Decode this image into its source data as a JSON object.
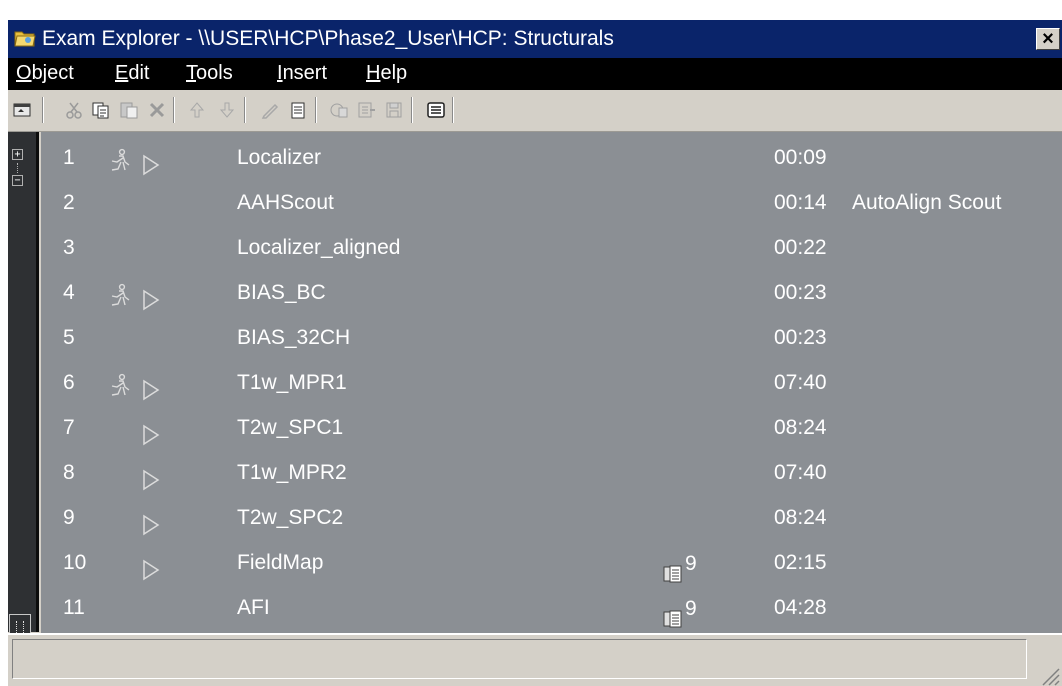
{
  "window": {
    "title": "Exam Explorer - \\\\USER\\HCP\\Phase2_User\\HCP: Structurals",
    "close_label": "×"
  },
  "menu": [
    "Object",
    "Edit",
    "Tools",
    "Insert",
    "Help"
  ],
  "toolbar": {
    "buttons": [
      "view-icon",
      "cut-icon",
      "copy-icon",
      "paste-icon",
      "delete-icon",
      "move-up-icon",
      "move-down-icon",
      "edit-icon",
      "properties-icon",
      "import-icon",
      "export-icon",
      "save-icon",
      "list-icon"
    ]
  },
  "tree": {
    "expand_glyph": "+",
    "collapse_glyph": "−"
  },
  "protocols": [
    {
      "num": "1",
      "name": "Localizer",
      "time": "00:09",
      "info": "",
      "patient_icon": true,
      "arrow": true,
      "images": ""
    },
    {
      "num": "2",
      "name": "AAHScout",
      "time": "00:14",
      "info": "AutoAlign Scout",
      "patient_icon": false,
      "arrow": false,
      "images": ""
    },
    {
      "num": "3",
      "name": "Localizer_aligned",
      "time": "00:22",
      "info": "",
      "patient_icon": false,
      "arrow": false,
      "images": ""
    },
    {
      "num": "4",
      "name": "BIAS_BC",
      "time": "00:23",
      "info": "",
      "patient_icon": true,
      "arrow": true,
      "images": ""
    },
    {
      "num": "5",
      "name": "BIAS_32CH",
      "time": "00:23",
      "info": "",
      "patient_icon": false,
      "arrow": false,
      "images": ""
    },
    {
      "num": "6",
      "name": "T1w_MPR1",
      "time": "07:40",
      "info": "",
      "patient_icon": true,
      "arrow": true,
      "images": ""
    },
    {
      "num": "7",
      "name": "T2w_SPC1",
      "time": "08:24",
      "info": "",
      "patient_icon": false,
      "arrow": true,
      "images": ""
    },
    {
      "num": "8",
      "name": "T1w_MPR2",
      "time": "07:40",
      "info": "",
      "patient_icon": false,
      "arrow": true,
      "images": ""
    },
    {
      "num": "9",
      "name": "T2w_SPC2",
      "time": "08:24",
      "info": "",
      "patient_icon": false,
      "arrow": true,
      "images": ""
    },
    {
      "num": "10",
      "name": "FieldMap",
      "time": "02:15",
      "info": "",
      "patient_icon": false,
      "arrow": true,
      "images": "9"
    },
    {
      "num": "11",
      "name": "AFI",
      "time": "04:28",
      "info": "",
      "patient_icon": false,
      "arrow": false,
      "images": "9"
    }
  ],
  "colors": {
    "titlebar": "#0a246a",
    "menubar": "#000000",
    "list_bg": "#8b8f94",
    "chrome": "#d4d0c8"
  }
}
